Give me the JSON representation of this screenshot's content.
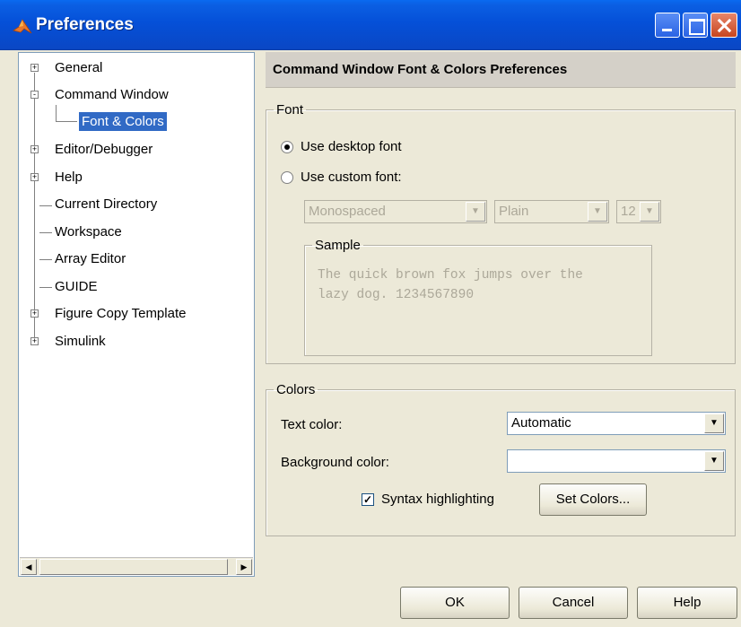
{
  "window": {
    "title": "Preferences",
    "controls": {
      "minimize": "minimize-icon",
      "maximize": "maximize-icon",
      "close": "close-icon"
    }
  },
  "tree": {
    "items": [
      {
        "label": "General",
        "expander": "+"
      },
      {
        "label": "Command Window",
        "expander": "-"
      },
      {
        "label": "Font & Colors",
        "selected": true
      },
      {
        "label": "Editor/Debugger",
        "expander": "+"
      },
      {
        "label": "Help",
        "expander": "+"
      },
      {
        "label": "Current Directory"
      },
      {
        "label": "Workspace"
      },
      {
        "label": "Array Editor"
      },
      {
        "label": "GUIDE"
      },
      {
        "label": "Figure Copy Template",
        "expander": "+"
      },
      {
        "label": "Simulink",
        "expander": "+"
      }
    ]
  },
  "panel": {
    "header": "Command Window Font & Colors Preferences",
    "font": {
      "legend": "Font",
      "desktop_label": "Use desktop font",
      "custom_label": "Use custom font:",
      "selected": "desktop",
      "family": "Monospaced",
      "style": "Plain",
      "size": "12",
      "sample_legend": "Sample",
      "sample_line1": "The quick brown fox jumps over the",
      "sample_line2": "lazy dog. 1234567890"
    },
    "colors": {
      "legend": "Colors",
      "text_color_label": "Text color:",
      "text_color_value": "Automatic",
      "background_label": "Background color:",
      "background_value": "",
      "syntax_label": "Syntax highlighting",
      "syntax_checked": true,
      "set_colors_button": "Set Colors..."
    }
  },
  "buttons": {
    "ok": "OK",
    "cancel": "Cancel",
    "help": "Help"
  }
}
